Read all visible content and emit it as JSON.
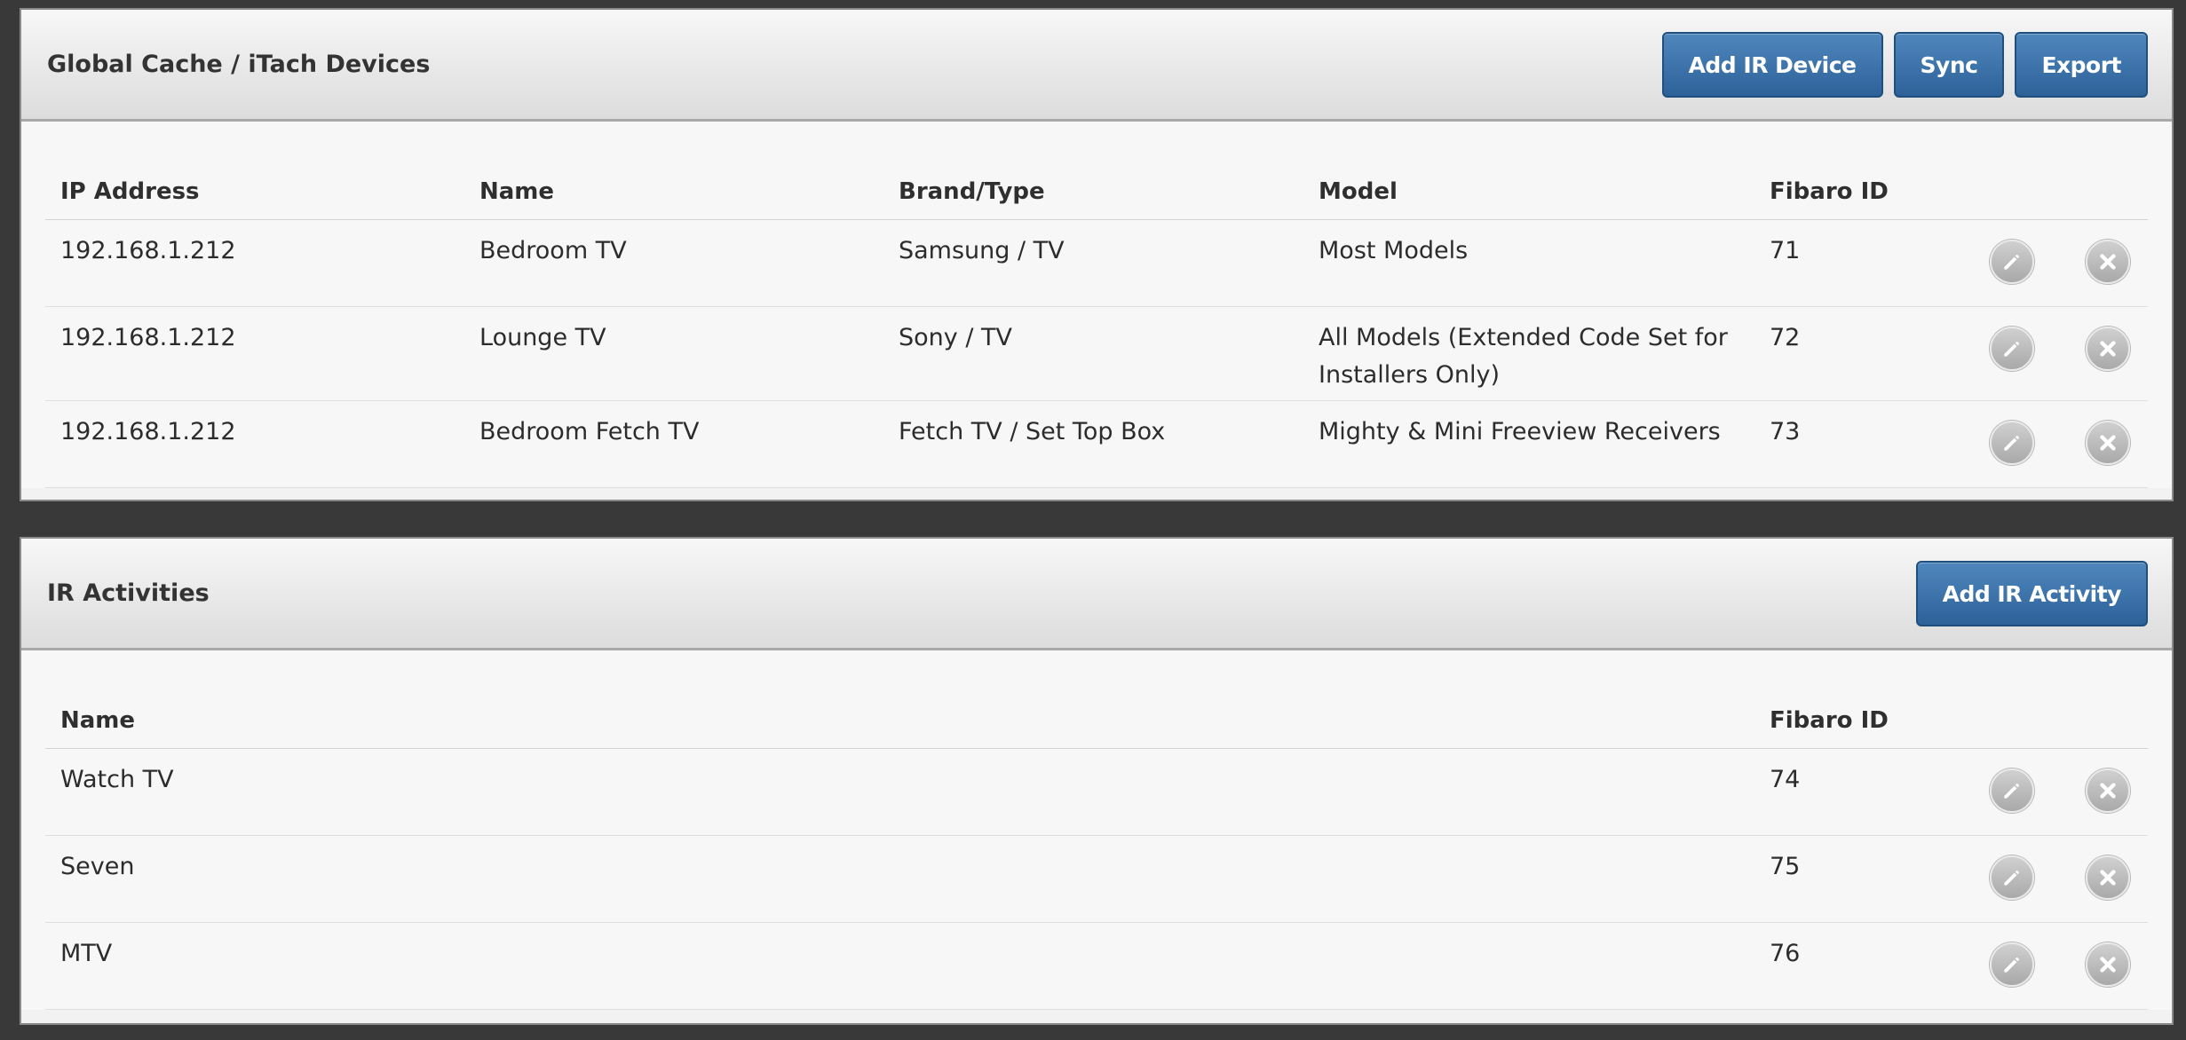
{
  "devices_panel": {
    "title": "Global Cache / iTach Devices",
    "buttons": {
      "add": "Add IR Device",
      "sync": "Sync",
      "export": "Export"
    },
    "columns": {
      "ip": "IP Address",
      "name": "Name",
      "brand": "Brand/Type",
      "model": "Model",
      "fibaro": "Fibaro ID"
    },
    "rows": [
      {
        "ip": "192.168.1.212",
        "name": "Bedroom TV",
        "brand": "Samsung / TV",
        "model": "Most Models",
        "fibaro": "71"
      },
      {
        "ip": "192.168.1.212",
        "name": "Lounge TV",
        "brand": "Sony / TV",
        "model": "All Models (Extended Code Set for Installers Only)",
        "fibaro": "72"
      },
      {
        "ip": "192.168.1.212",
        "name": "Bedroom Fetch TV",
        "brand": "Fetch TV / Set Top Box",
        "model": "Mighty & Mini Freeview Receivers",
        "fibaro": "73"
      }
    ]
  },
  "activities_panel": {
    "title": "IR Activities",
    "buttons": {
      "add": "Add IR Activity"
    },
    "columns": {
      "name": "Name",
      "fibaro": "Fibaro ID"
    },
    "rows": [
      {
        "name": "Watch TV",
        "fibaro": "74"
      },
      {
        "name": "Seven",
        "fibaro": "75"
      },
      {
        "name": "MTV",
        "fibaro": "76"
      }
    ]
  },
  "icons": {
    "edit": "pencil-icon",
    "delete": "close-icon"
  },
  "colors": {
    "background": "#393939",
    "primary_button": "#3a70a8",
    "icon_button": "#b8b8b8"
  }
}
